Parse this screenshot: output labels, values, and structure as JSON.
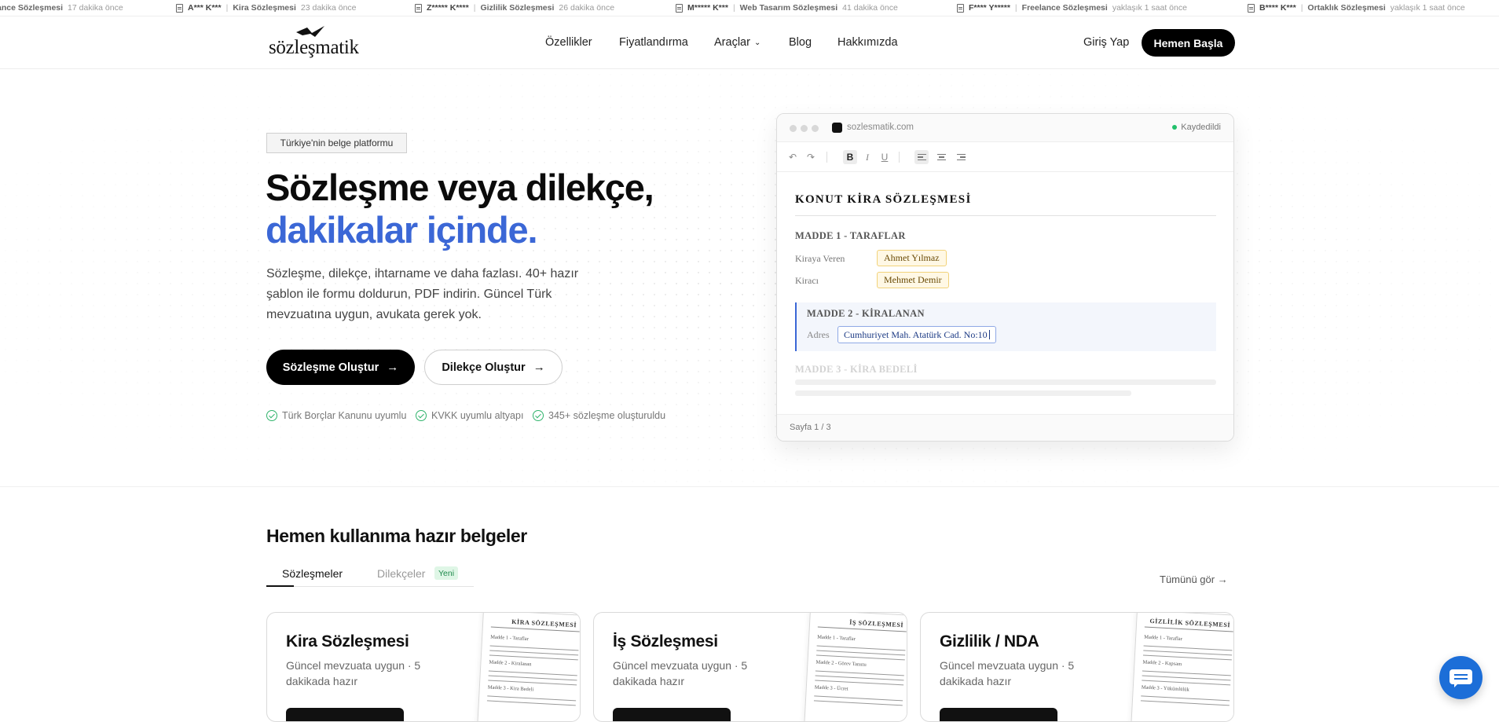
{
  "ticker": [
    {
      "name": "",
      "type": "ance Sözleşmesi",
      "time": "17 dakika önce"
    },
    {
      "name": "A*** K***",
      "type": "Kira Sözleşmesi",
      "time": "23 dakika önce"
    },
    {
      "name": "Z***** K****",
      "type": "Gizlilik Sözleşmesi",
      "time": "26 dakika önce"
    },
    {
      "name": "M***** K***",
      "type": "Web Tasarım Sözleşmesi",
      "time": "41 dakika önce"
    },
    {
      "name": "F**** Y*****",
      "type": "Freelance Sözleşmesi",
      "time": "yaklaşık 1 saat önce"
    },
    {
      "name": "B**** K***",
      "type": "Ortaklık Sözleşmesi",
      "time": "yaklaşık 1 saat önce"
    }
  ],
  "header": {
    "logo": "sözleşmatik",
    "nav": [
      "Özellikler",
      "Fiyatlandırma",
      "Araçlar",
      "Blog",
      "Hakkımızda"
    ],
    "login": "Giriş Yap",
    "cta": "Hemen Başla"
  },
  "hero": {
    "badge": "Türkiye'nin belge platformu",
    "title_line1": "Sözleşme veya dilekçe,",
    "title_line2": "dakikalar içinde.",
    "lead": "Sözleşme, dilekçe, ihtarname ve daha fazlası. 40+ hazır şablon ile formu doldurun, PDF indirin. Güncel Türk mevzuatına uygun, avukata gerek yok.",
    "btn_primary": "Sözleşme Oluştur",
    "btn_secondary": "Dilekçe Oluştur",
    "features": [
      "Türk Borçlar Kanunu uyumlu",
      "KVKK uyumlu altyapı",
      "345+ sözleşme oluşturuldu"
    ]
  },
  "editor": {
    "url": "sozlesmatik.com",
    "status": "Kaydedildi",
    "doc_title": "KONUT KİRA SÖZLEŞMESİ",
    "madde1": "MADDE 1 - TARAFLAR",
    "label_landlord": "Kiraya Veren",
    "value_landlord": "Ahmet Yılmaz",
    "label_tenant": "Kiracı",
    "value_tenant": "Mehmet Demir",
    "madde2": "MADDE 2 - KİRALANAN",
    "label_address": "Adres",
    "value_address": "Cumhuriyet Mah. Atatürk Cad. No:10",
    "madde3": "MADDE 3 - KİRA BEDELİ",
    "page": "Sayfa 1 / 3"
  },
  "templates": {
    "title": "Hemen kullanıma hazır belgeler",
    "tab_contracts": "Sözleşmeler",
    "tab_petitions": "Dilekçeler",
    "new_badge": "Yeni",
    "see_all": "Tümünü gör →",
    "cards": [
      {
        "title": "Kira Sözleşmesi",
        "subtitle": "Güncel mevzuata uygun · 5 dakikada hazır",
        "paper_title": "KİRA SÖZLEŞMESİ",
        "paper_items": [
          "Madde 1 - Taraflar",
          "Madde 2 - Kiralanan",
          "Madde 3 - Kira Bedeli"
        ]
      },
      {
        "title": "İş Sözleşmesi",
        "subtitle": "Güncel mevzuata uygun · 5 dakikada hazır",
        "paper_title": "İŞ SÖZLEŞMESİ",
        "paper_items": [
          "Madde 1 - Taraflar",
          "Madde 2 - Görev Tanımı",
          "Madde 3 - Ücret"
        ]
      },
      {
        "title": "Gizlilik / NDA",
        "subtitle": "Güncel mevzuata uygun · 5 dakikada hazır",
        "paper_title": "GİZLİLİK SÖZLEŞMESİ",
        "paper_items": [
          "Madde 1 - Taraflar",
          "Madde 2 - Kapsam",
          "Madde 3 - Yükümlülük"
        ]
      }
    ]
  },
  "colors": {
    "accent": "#3b67d6",
    "primary": "#000000",
    "success": "#2fb36b",
    "chat": "#1c6ed8"
  }
}
